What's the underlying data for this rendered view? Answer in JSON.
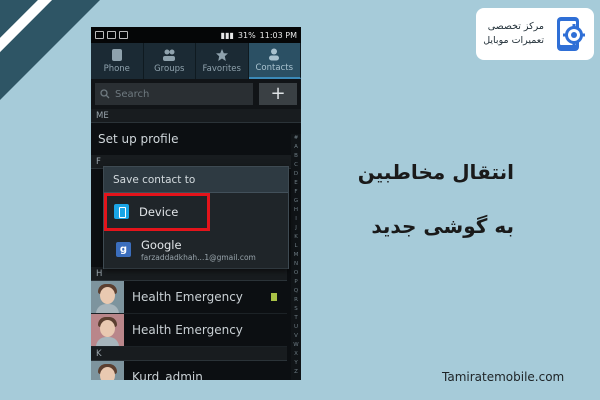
{
  "phone": {
    "status": {
      "battery": "31%",
      "time": "11:03 PM"
    },
    "tabs": [
      {
        "label": "Phone",
        "icon": "phone-icon"
      },
      {
        "label": "Groups",
        "icon": "groups-icon"
      },
      {
        "label": "Favorites",
        "icon": "star-icon"
      },
      {
        "label": "Contacts",
        "icon": "contacts-icon",
        "active": true
      }
    ],
    "search": {
      "placeholder": "Search",
      "add_label": "+"
    },
    "sections": {
      "me": "ME",
      "f": "F",
      "h": "H",
      "k": "K"
    },
    "profile_label": "Set up profile",
    "dialog": {
      "title": "Save contact to",
      "options": [
        {
          "label": "Device",
          "icon": "device-icon",
          "highlighted": true
        },
        {
          "label": "Google",
          "sub": "farzaddadkhah...1@gmail.com",
          "icon": "google-icon"
        }
      ]
    },
    "contacts": [
      {
        "name": "Health Emergency"
      },
      {
        "name": "Health Emergency"
      },
      {
        "name": "Kurd_admin"
      }
    ],
    "index_letters": [
      "#",
      "A",
      "B",
      "C",
      "D",
      "E",
      "F",
      "G",
      "H",
      "I",
      "J",
      "K",
      "L",
      "M",
      "N",
      "O",
      "P",
      "Q",
      "R",
      "S",
      "T",
      "U",
      "V",
      "W",
      "X",
      "Y",
      "Z"
    ]
  },
  "brand": {
    "line1": "مرکز تخصصی",
    "line2": "تعمیرات موبایل"
  },
  "headline": {
    "line1": "انتقال مخاطبین",
    "line2": "به گوشی جدید"
  },
  "site": "Tamiratemobile.com",
  "colors": {
    "background": "#a6cbd9",
    "highlight": "#e3141b",
    "brand_blue": "#2f6fd6"
  }
}
